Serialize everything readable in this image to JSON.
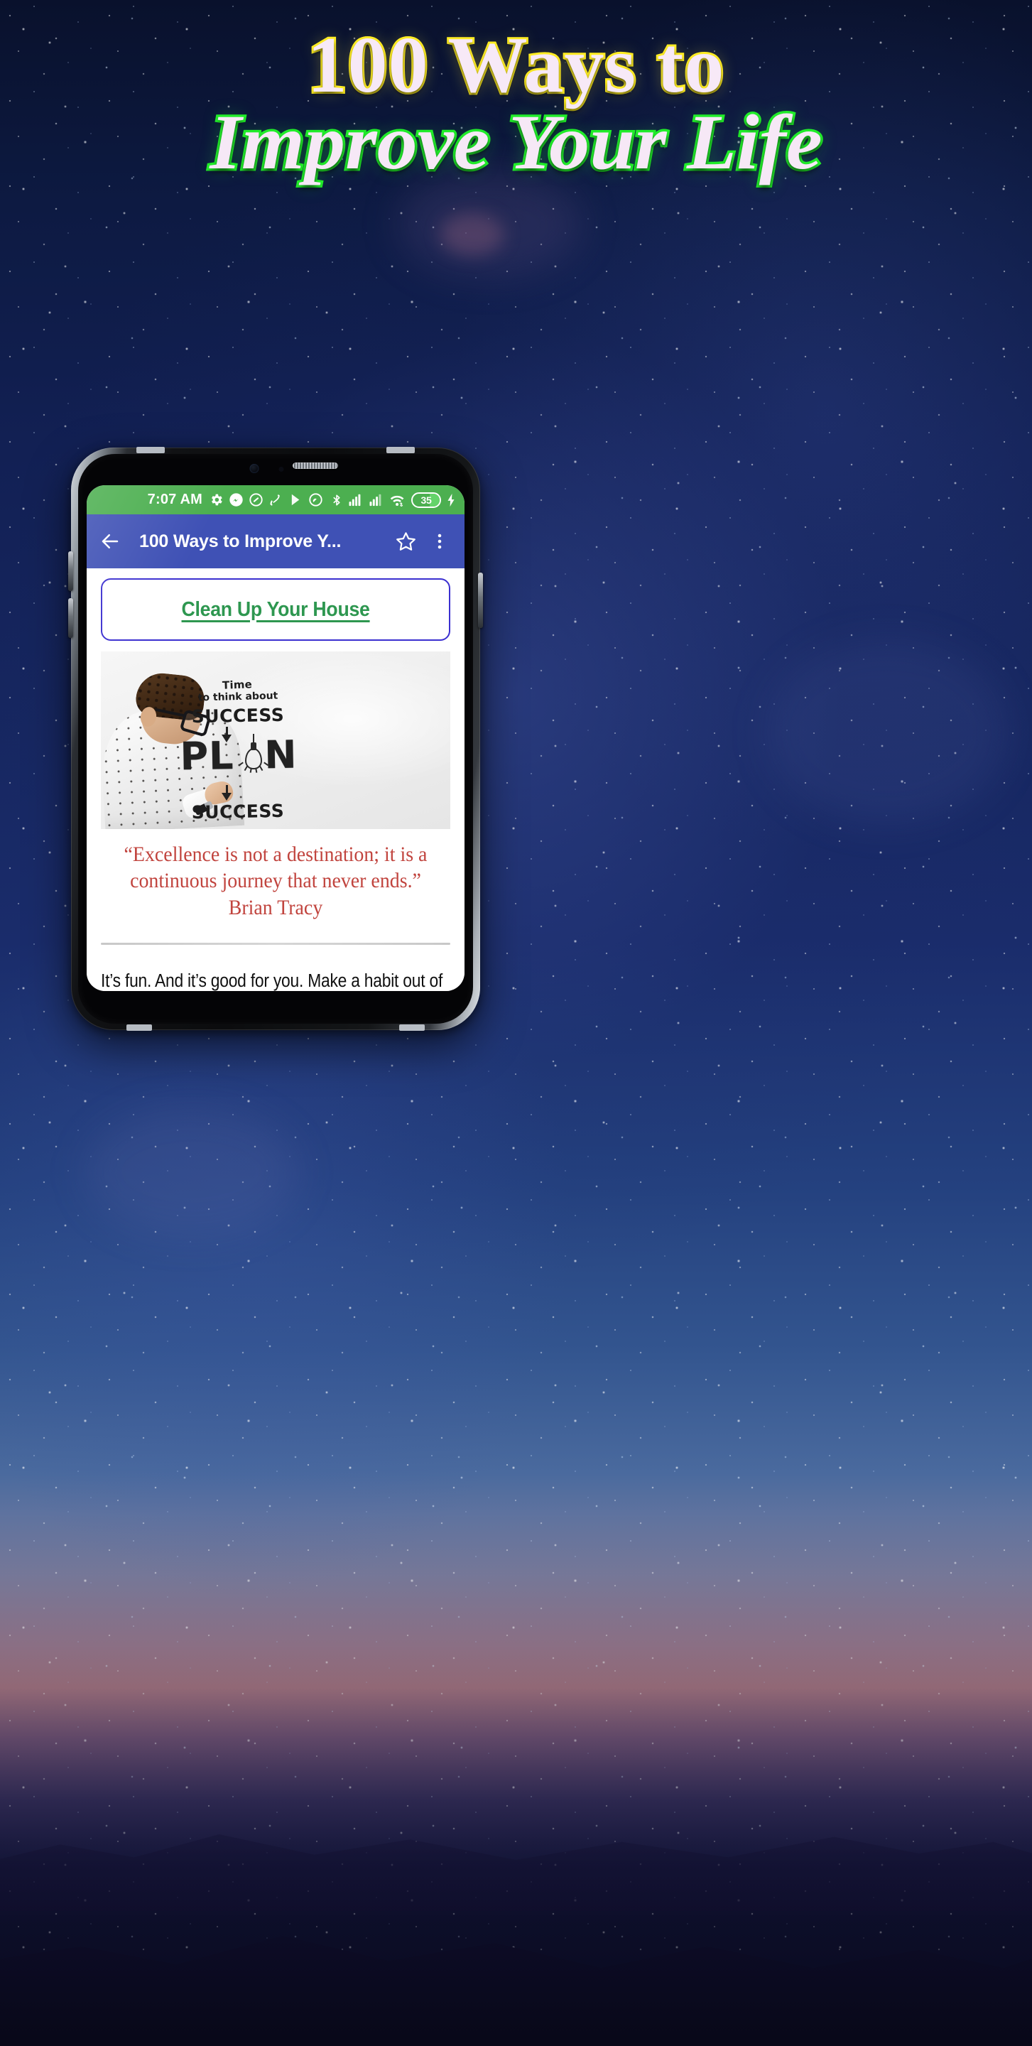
{
  "promo": {
    "title_line1": "100 Ways to",
    "title_line2": "Improve Your Life",
    "title_line1_color": "#f7e9f7",
    "title_line1_outline": "#ffee22",
    "title_line2_outline": "#22ee2a",
    "background": "night-starry-sky"
  },
  "phone": {
    "statusbar": {
      "clock": "7:07 AM",
      "background_color": "#4CAF50",
      "left_icons": [
        "gear-icon",
        "messenger-icon",
        "do-not-disturb-icon",
        "telenor-icon",
        "play-store-icon",
        "android-auto-icon"
      ],
      "right_icons": [
        "bluetooth-icon",
        "signal-sim1-icon",
        "signal-sim2-icon",
        "wifi-icon"
      ],
      "battery_percent": "35",
      "battery_charging": true
    },
    "toolbar": {
      "background_color": "#3F51B5",
      "back_label": "back-arrow",
      "title": "100 Ways to Improve Y...",
      "favorite_label": "star-outline",
      "overflow_label": "more-options"
    },
    "article": {
      "heading": "Clean Up Your House ",
      "heading_color": "#2e9750",
      "heading_border_color": "#3b2fd0",
      "hero_image": {
        "alt": "man writing on a whiteboard",
        "board_lines": {
          "line1": "Time",
          "line2": "to think about",
          "line3": "SUCCESS",
          "line4": "PL",
          "line4b": "N",
          "line5": "SUCCESS"
        }
      },
      "quote": {
        "text": "“Excellence is not a destination; it is a continuous journey that never ends.”",
        "author": "Brian Tracy",
        "color": "#c1443e"
      },
      "body": "It’s fun. And it’s good for you. Make a habit out of cleaning up your house with joy and happiness. What’s outside is a mirror of what’s inside. If your house is a mess, probably your internal life is a disaster. Neat that stuff, it’s easy. Some people chose to delegate this task: I have a housekeeper, why should I bother? Well, I think there are some boundaries you should not trespass. Cleaning up my house is a very private thing for me. I prefer to spend an entire day cleaning my house and keep certain privacy rather than delegating and lose it. Your house is in fact an extension of yourself, it"
    }
  }
}
